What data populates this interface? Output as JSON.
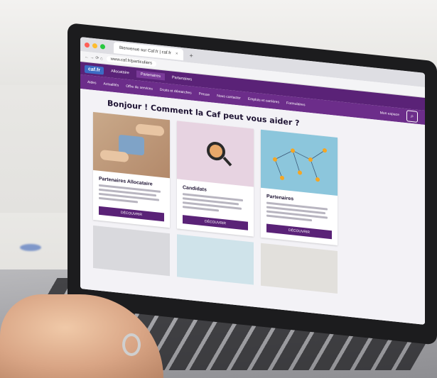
{
  "browser": {
    "tab_title": "Bienvenue sur Caf.fr | caf.fr",
    "tab_close": "×",
    "new_tab": "+",
    "nav_controls": "← → ⟳ ⌂",
    "url": "www.caf.fr/particuliers"
  },
  "site": {
    "logo": "caf.fr",
    "top_nav": [
      "Allocataire",
      "Partenaires",
      "Partenaires"
    ],
    "sub_nav": [
      "Aides",
      "Actualités",
      "Offre de services",
      "Droits et démarches",
      "Presse",
      "Nous contacter",
      "Emplois et carrières",
      "Formulaires"
    ],
    "account_label": "Mon espace",
    "search_icon": "search-icon",
    "headline": "Bonjour ! Comment la Caf peut vous aider ?",
    "cards": [
      {
        "title": "Partenaires Allocataire",
        "button": "DÉCOUVRIR",
        "image": "puzzle-hands-image"
      },
      {
        "title": "Candidats",
        "button": "DÉCOUVRIR",
        "image": "magnifier-image"
      },
      {
        "title": "Partenaires",
        "button": "DÉCOUVRIR",
        "image": "network-image"
      }
    ]
  },
  "colors": {
    "brand_purple": "#5a2277",
    "subnav_purple": "#6c2d8a",
    "logo_blue": "#3c6bc4"
  }
}
